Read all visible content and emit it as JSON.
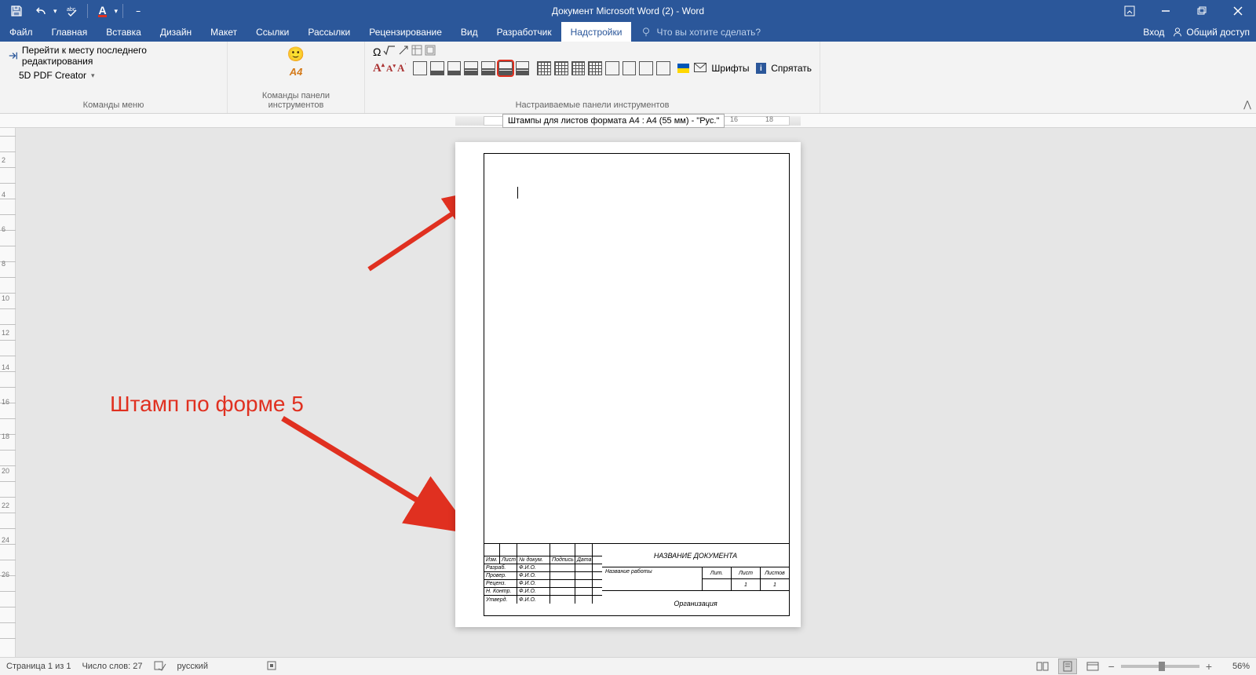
{
  "title": "Документ Microsoft Word (2) - Word",
  "qat": {
    "save": "save",
    "undo": "undo",
    "spellcheck": "spellcheck",
    "fontcolor": "A",
    "customize": "customize"
  },
  "tabs": [
    "Файл",
    "Главная",
    "Вставка",
    "Дизайн",
    "Макет",
    "Ссылки",
    "Рассылки",
    "Рецензирование",
    "Вид",
    "Разработчик",
    "Надстройки"
  ],
  "active_tab": "Надстройки",
  "tell_me": "Что вы хотите сделать?",
  "right_title": {
    "signin": "Вход",
    "share": "Общий доступ"
  },
  "ribbon": {
    "group1": {
      "label": "Команды меню",
      "goto": "Перейти к месту последнего редактирования",
      "pdf": "5D PDF Creator"
    },
    "group2": {
      "label": "Команды панели инструментов",
      "a4": "А4"
    },
    "group3": {
      "label": "Настраиваемые панели инструментов",
      "fonts": "Шрифты",
      "hide": "Спрятать"
    }
  },
  "tooltip": "Штампы для листов формата A4 : A4 (55 мм) - \"Рус.\"",
  "hruler": {
    "n16": "16",
    "n18": "18"
  },
  "titleblock": {
    "docname": "НАЗВАНИЕ ДОКУМЕНТА",
    "workname": "Название работы",
    "org": "Организация",
    "hdr": {
      "izm": "Изм.",
      "list": "Лист",
      "ndoc": "№ докум.",
      "sign": "Подпись",
      "date": "Дата"
    },
    "rows": [
      "Разраб.",
      "Провер.",
      "Реценз.",
      "Н. Контр.",
      "Утверд."
    ],
    "fio": "Ф.И.О.",
    "sheets": {
      "lit": "Лит.",
      "list": "Лист",
      "listov": "Листов",
      "v1": "1",
      "v2": "1"
    }
  },
  "vruler": [
    " ",
    "2",
    "",
    "4",
    "",
    "6",
    "",
    "8",
    "",
    "10",
    "",
    "12",
    "",
    "14",
    "",
    "16",
    "",
    "18",
    "",
    "20",
    "",
    "22",
    "",
    "24",
    "",
    "26",
    ""
  ],
  "annotation": "Штамп по форме 5",
  "status": {
    "page": "Страница 1 из 1",
    "words": "Число слов: 27",
    "lang": "русский",
    "zoom": "56%"
  }
}
